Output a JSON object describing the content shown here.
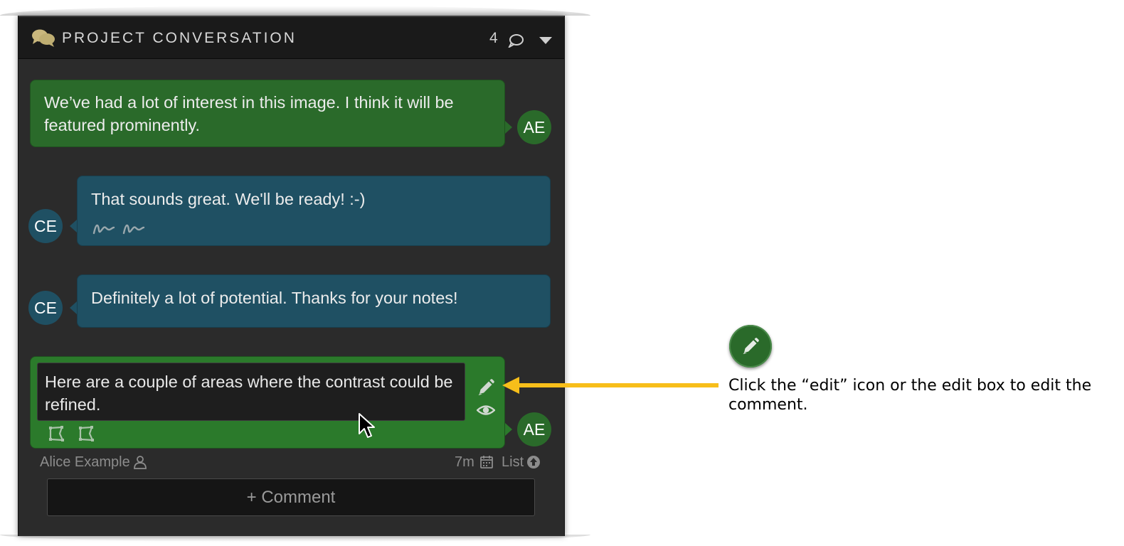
{
  "panel": {
    "title": "PROJECT CONVERSATION",
    "comment_count": "4",
    "icons": {
      "header": "chat-bubbles-icon",
      "count": "speech-bubble-icon",
      "collapse": "caret-down-icon"
    }
  },
  "messages": [
    {
      "author_initials": "AE",
      "text": "We’ve had a lot of interest in this image. I think it will be featured prominently.",
      "color": "#2a6a2a"
    },
    {
      "author_initials": "CE",
      "text": "That sounds great. We'll be ready! :-)",
      "has_annotations": true,
      "color": "#1f5063"
    },
    {
      "author_initials": "CE",
      "text": "Definitely a lot of potential. Thanks for your notes!",
      "color": "#1f5063"
    }
  ],
  "active_comment": {
    "author_initials": "AE",
    "text": "Here are a couple of areas where the contrast could be refined.",
    "author_name": "Alice Example",
    "time_ago": "7m",
    "list_label": "List",
    "icons": [
      "pencil-icon",
      "eye-icon",
      "region-icon",
      "region-icon",
      "person-icon",
      "calendar-icon",
      "arrow-up-circle-icon"
    ]
  },
  "add_comment_button": "+ Comment",
  "callout": {
    "text": "Click the “edit” icon or the edit box to edit the comment.",
    "icon": "pencil-icon",
    "arrow_color": "#f7be1a"
  }
}
